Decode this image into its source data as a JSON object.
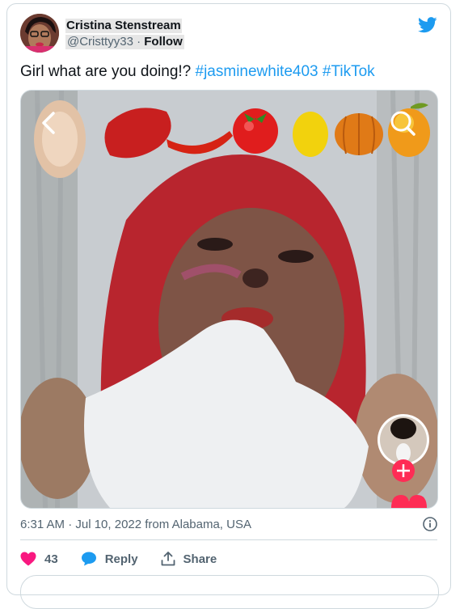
{
  "author": {
    "name": "Cristina Stenstream",
    "handle": "@Cristtyy33",
    "separator": "·",
    "follow_label": "Follow"
  },
  "tweet": {
    "text": "Girl what are you doing!?",
    "hashtags": [
      "#jasminewhite403",
      "#TikTok"
    ]
  },
  "media": {
    "back_icon": "chevron-left-icon",
    "search_icon": "search-icon",
    "add_icon": "plus-icon",
    "food_icons": [
      "raw-chicken-icon",
      "red-meat-icon",
      "chili-pepper-icon",
      "tomato-icon",
      "lemon-icon",
      "pumpkin-icon",
      "mango-icon"
    ]
  },
  "meta": {
    "timestamp": "6:31 AM · Jul 10, 2022 from Alabama, USA"
  },
  "actions": {
    "likes": "43",
    "reply_label": "Reply",
    "share_label": "Share"
  },
  "colors": {
    "twitter_blue": "#1d9bf0",
    "like_pink": "#f91880",
    "text_secondary": "#536471",
    "border": "#cfd9de",
    "add_button": "#fe2c55"
  }
}
